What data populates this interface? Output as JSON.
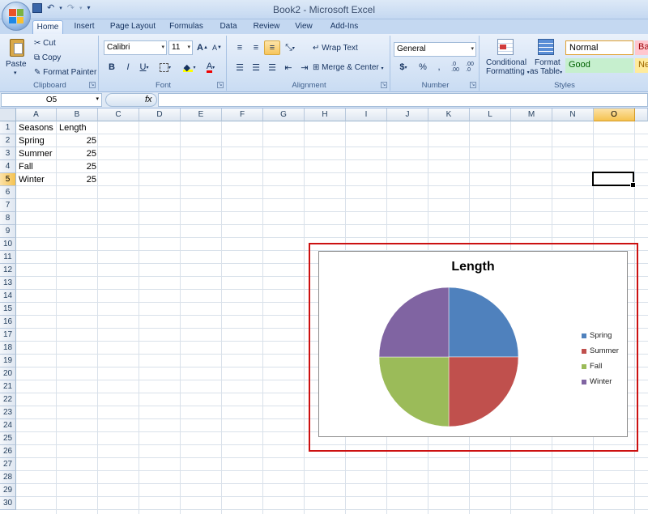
{
  "window": {
    "title": "Book2 - Microsoft Excel"
  },
  "quick_access": {
    "undo_label": "↶",
    "redo_label": "↷"
  },
  "tabs": [
    {
      "label": "Home"
    },
    {
      "label": "Insert"
    },
    {
      "label": "Page Layout"
    },
    {
      "label": "Formulas"
    },
    {
      "label": "Data"
    },
    {
      "label": "Review"
    },
    {
      "label": "View"
    },
    {
      "label": "Add-Ins"
    }
  ],
  "ribbon": {
    "clipboard": {
      "label": "Clipboard",
      "paste": "Paste",
      "cut": "Cut",
      "copy": "Copy",
      "format_painter": "Format Painter"
    },
    "font": {
      "label": "Font",
      "font_name": "Calibri",
      "font_size": "11"
    },
    "alignment": {
      "label": "Alignment",
      "wrap_text": "Wrap Text",
      "merge_center": "Merge & Center"
    },
    "number": {
      "label": "Number",
      "format": "General",
      "currency": "$",
      "percent": "%",
      "comma": ","
    },
    "styles": {
      "label": "Styles",
      "conditional": "Conditional",
      "formatting": "Formatting",
      "format": "Format",
      "as_table": "as Table",
      "normal": "Normal",
      "bad": "Ba",
      "good": "Good",
      "neutral": "Ne"
    }
  },
  "formula_bar": {
    "name_box": "O5",
    "fx": "fx",
    "content": ""
  },
  "sheet": {
    "columns": [
      "A",
      "B",
      "C",
      "D",
      "E",
      "F",
      "G",
      "H",
      "I",
      "J",
      "K",
      "L",
      "M",
      "N",
      "O"
    ],
    "rows": [
      "1",
      "2",
      "3",
      "4",
      "5",
      "6",
      "7",
      "8",
      "9",
      "10",
      "11",
      "12",
      "13",
      "14",
      "15",
      "16",
      "17",
      "18",
      "19",
      "20",
      "21",
      "22",
      "23",
      "24",
      "25",
      "26",
      "27",
      "28",
      "29",
      "30"
    ],
    "selected_column": "O",
    "selected_row": "5",
    "cells": [
      {
        "a": "Seasons",
        "b": "Length"
      },
      {
        "a": "Spring",
        "b": "25"
      },
      {
        "a": "Summer",
        "b": "25"
      },
      {
        "a": "Fall",
        "b": "25"
      },
      {
        "a": "Winter",
        "b": "25"
      }
    ]
  },
  "chart_data": {
    "type": "pie",
    "title": "Length",
    "categories": [
      "Spring",
      "Summer",
      "Fall",
      "Winter"
    ],
    "values": [
      25,
      25,
      25,
      25
    ],
    "colors": [
      "#4f81bd",
      "#c0504d",
      "#9bbb59",
      "#8064a2"
    ],
    "legend": "right"
  }
}
